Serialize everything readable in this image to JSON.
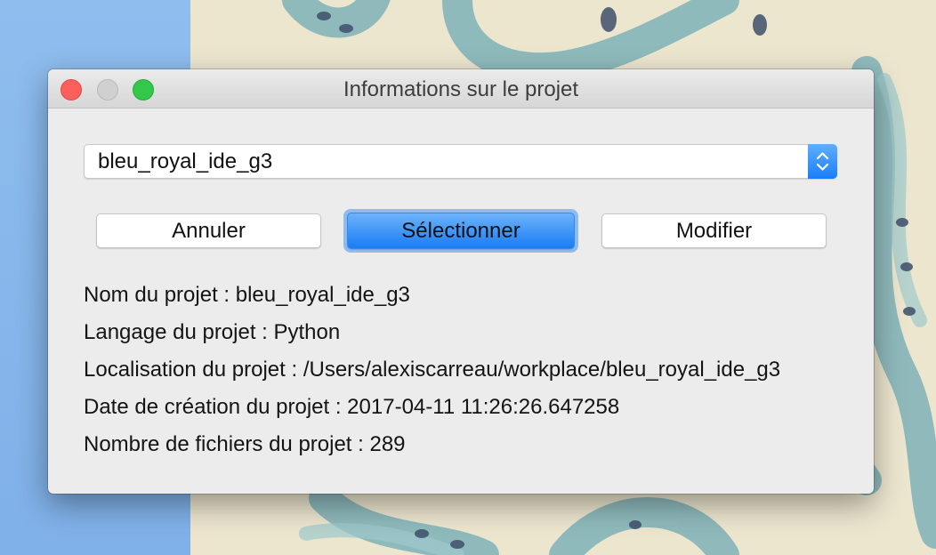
{
  "window": {
    "title": "Informations sur le projet"
  },
  "project_select": {
    "value": "bleu_royal_ide_g3"
  },
  "buttons": {
    "cancel": "Annuler",
    "select": "Sélectionner",
    "modify": "Modifier"
  },
  "info": {
    "name": "Nom du projet : bleu_royal_ide_g3",
    "language": "Langage du projet : Python",
    "location": "Localisation du projet : /Users/alexiscarreau/workplace/bleu_royal_ide_g3",
    "created": "Date de création du projet : 2017-04-11 11:26:26.647258",
    "file_count": "Nombre de fichiers du projet : 289"
  },
  "colors": {
    "accent": "#1a7cf5",
    "close": "#fc605c",
    "zoom": "#34c84a",
    "desktop_blue": "#8fbdee"
  },
  "icons": {
    "combo": "up-down-chevrons-icon"
  }
}
